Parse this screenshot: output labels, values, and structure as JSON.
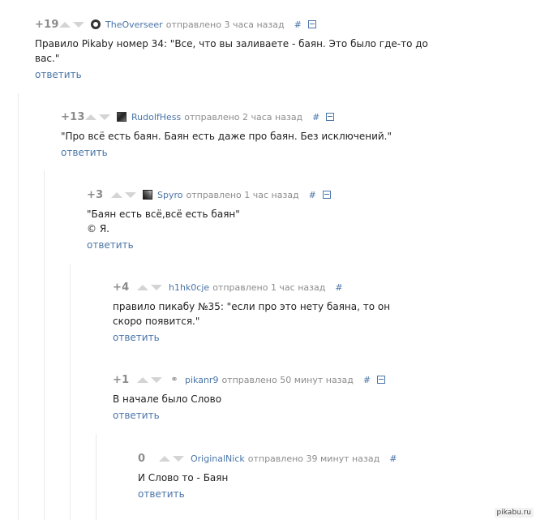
{
  "comments": [
    {
      "rating": "+19",
      "username": "TheOverseer",
      "time": "отправлено 3 часа назад",
      "avatar": "ring-avatar-icon",
      "lines": [
        "Правило Pikaby номер 34: \"Все, что вы заливаете - баян. Это было где-то до",
        "вас.\""
      ],
      "reply": "ответить",
      "hash": "#"
    },
    {
      "rating": "+13",
      "username": "RudolfHess",
      "time": "отправлено 2 часа назад",
      "avatar": "photo-avatar-icon",
      "lines": [
        "\"Про всё есть баян. Баян есть даже про баян. Без исключений.\""
      ],
      "reply": "ответить",
      "hash": "#"
    },
    {
      "rating": "+3",
      "username": "Spyro",
      "time": "отправлено 1 час назад",
      "avatar": "photo-avatar-icon",
      "lines": [
        "\"Баян есть всё,всё есть баян\"",
        "© Я."
      ],
      "reply": "ответить",
      "hash": "#"
    },
    {
      "rating": "+4",
      "username": "h1hk0cje",
      "time": "отправлено 1 час назад",
      "lines": [
        "правило пикабу №35: \"если про это нету баяна, то он",
        "скоро появится.\""
      ],
      "reply": "ответить",
      "hash": "#"
    },
    {
      "rating": "+1",
      "username": "pikanr9",
      "time": "отправлено 50 минут назад",
      "avatar": "link-avatar-icon",
      "lines": [
        "В начале было Слово"
      ],
      "reply": "ответить",
      "hash": "#"
    },
    {
      "rating": "0",
      "username": "OriginalNick",
      "time": "отправлено 39 минут назад",
      "lines": [
        "И Слово то - Баян"
      ],
      "reply": "ответить",
      "hash": "#"
    }
  ],
  "watermark": "pikabu.ru",
  "colors": {
    "link": "#4a75a8",
    "rating": "#8c8c8c",
    "arrow": "#d4d4d4",
    "text": "#222222"
  }
}
